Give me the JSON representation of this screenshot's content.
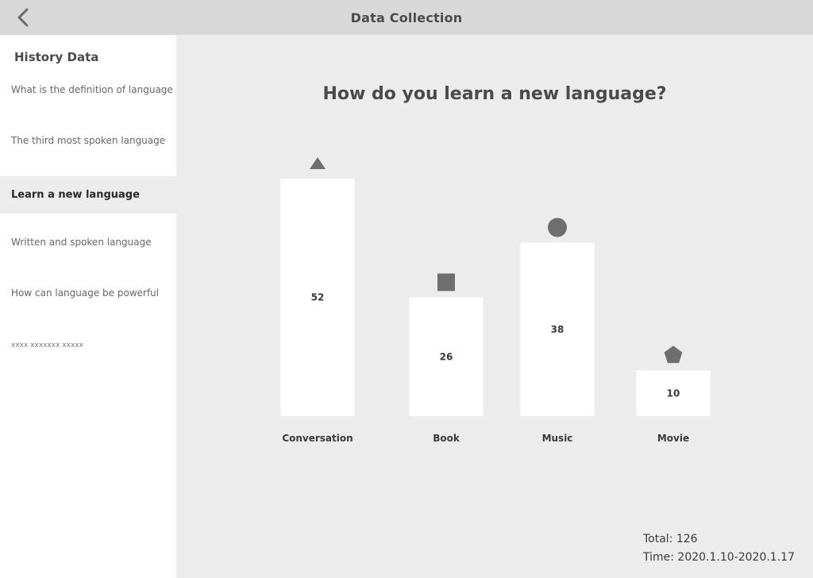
{
  "header": {
    "title": "Data Collection"
  },
  "sidebar": {
    "heading": "History Data",
    "items": [
      {
        "label": "What is the definition of language"
      },
      {
        "label": "The third most spoken language"
      },
      {
        "label": "Learn a new language"
      },
      {
        "label": "Written and spoken language"
      },
      {
        "label": "How can language be powerful"
      },
      {
        "label": "xxxx xxxxxxx xxxxx"
      }
    ]
  },
  "main": {
    "question": "How do you learn a new language?",
    "total_label": "Total: 126",
    "time_label": "Time: 2020.1.10-2020.1.17"
  },
  "chart_data": {
    "type": "bar",
    "categories": [
      "Conversation",
      "Book",
      "Music",
      "Movie"
    ],
    "values": [
      52,
      26,
      38,
      10
    ],
    "markers": [
      "triangle",
      "square",
      "circle",
      "pentagon"
    ],
    "ylim": [
      0,
      52
    ],
    "grid": false
  },
  "colors": {
    "header_bg": "#d8d8d8",
    "page_bg": "#ececec",
    "bar_fill": "#ffffff",
    "marker_fill": "#6e6e6e"
  }
}
